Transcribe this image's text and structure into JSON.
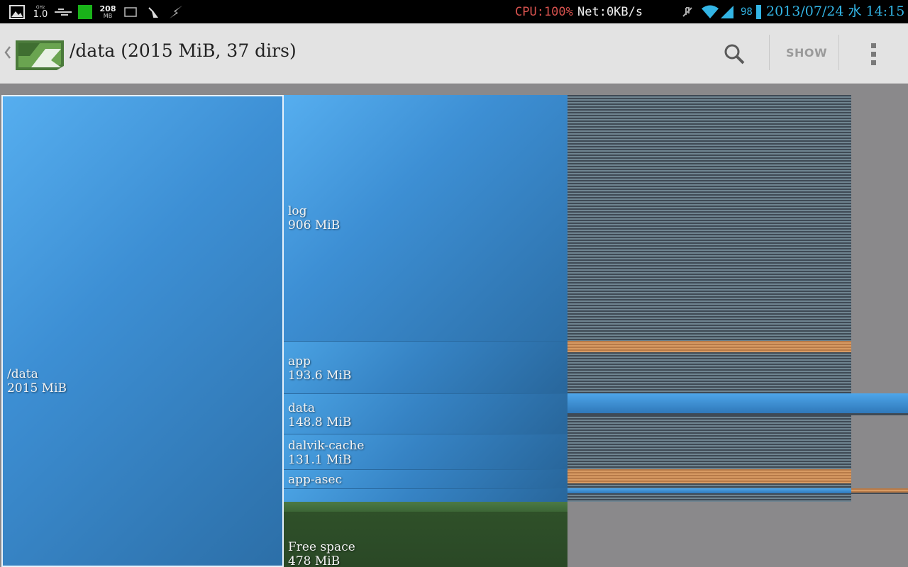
{
  "status_bar": {
    "cpu_text": "CPU:100%",
    "net_text": "Net:0KB/s",
    "ram_top": "208",
    "ram_bottom": "MB",
    "speed_top": "GHz",
    "speed_value": "1.0",
    "battery_level": "98",
    "datetime": "2013/07/24 水 14:15",
    "colors": {
      "cpu": "#d9534f",
      "clock": "#33b5e5"
    }
  },
  "action_bar": {
    "title": "/data (2015 MiB, 37 dirs)",
    "show_label": "SHOW",
    "icons": [
      "back-chevron-icon",
      "app-logo-icon",
      "search-icon",
      "overflow-menu-icon"
    ]
  },
  "treemap": {
    "root": {
      "name": "/data",
      "size": "2015 MiB"
    },
    "children": [
      {
        "name": "log",
        "size": "906 MiB"
      },
      {
        "name": "app",
        "size": "193.6 MiB"
      },
      {
        "name": "data",
        "size": "148.8 MiB"
      },
      {
        "name": "dalvik-cache",
        "size": "131.1 MiB"
      },
      {
        "name": "app-asec",
        "size": ""
      }
    ],
    "free_space": {
      "name": "Free space",
      "size": "478 MiB"
    },
    "colors": {
      "directory": "#3d8fd4",
      "file": "#5a6c78",
      "app_file": "#c98a52",
      "free": "#3c6636"
    }
  }
}
